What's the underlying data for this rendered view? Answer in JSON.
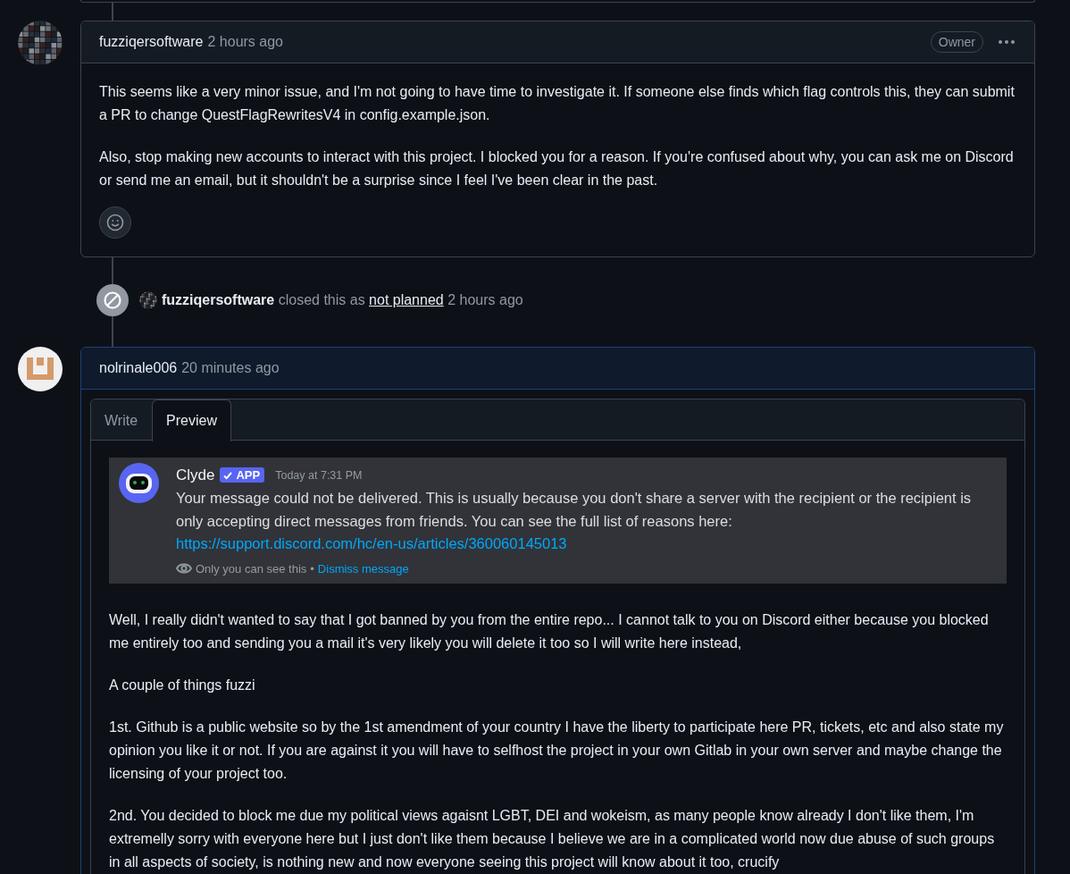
{
  "timeline": [
    {
      "kind": "comment",
      "author": "fuzziqersoftware",
      "time": "2 hours ago",
      "badge": "Owner",
      "paragraphs": [
        "This seems like a very minor issue, and I'm not going to have time to investigate it. If someone else finds which flag controls this, they can submit a PR to change QuestFlagRewritesV4 in config.example.json.",
        "Also, stop making new accounts to interact with this project. I blocked you for a reason. If you're confused about why, you can ask me on Discord or send me an email, but it shouldn't be a surprise since I feel I've been clear in the past."
      ]
    },
    {
      "kind": "event",
      "actor": "fuzziqersoftware",
      "action": "closed this as",
      "reason": "not planned",
      "time": "2 hours ago"
    },
    {
      "kind": "editor",
      "author": "nolrinale006",
      "time": "20 minutes ago",
      "tabs": [
        {
          "label": "Write",
          "selected": false
        },
        {
          "label": "Preview",
          "selected": true
        }
      ],
      "embed": {
        "name": "Clyde",
        "tag": "APP",
        "time": "Today at 7:31 PM",
        "message": "Your message could not be delivered. This is usually because you don't share a server with the recipient or the recipient is only accepting direct messages from friends. You can see the full list of reasons here:",
        "link": "https://support.discord.com/hc/en-us/articles/360060145013",
        "note": "Only you can see this",
        "separator": "•",
        "dismiss": "Dismiss message"
      },
      "paragraphs": [
        "Well, I really didn't wanted to say that I got banned by you from the entire repo... I cannot talk to you on Discord either because you blocked me entirely too and sending you a mail it's very likely you will delete it too so I will write here instead,",
        "A couple of things fuzzi",
        "1st. Github is a public website so by the 1st amendment of your country I have the liberty to participate here PR, tickets, etc and also state my opinion you like it or not. If you are against it you will have to selfhost the project in your own Gitlab in your own server and maybe change the licensing of your project too.",
        "2nd. You decided to block me due my political views agaisnt LGBT, DEI and wokeism, as many people know already I don't like them, I'm extremelly sorry with everyone here but I just don't like them because I believe we are in a complicated world now due abuse of such groups in all aspects of society, is nothing new and now everyone seeing this project will know about it too, crucify"
      ]
    }
  ]
}
